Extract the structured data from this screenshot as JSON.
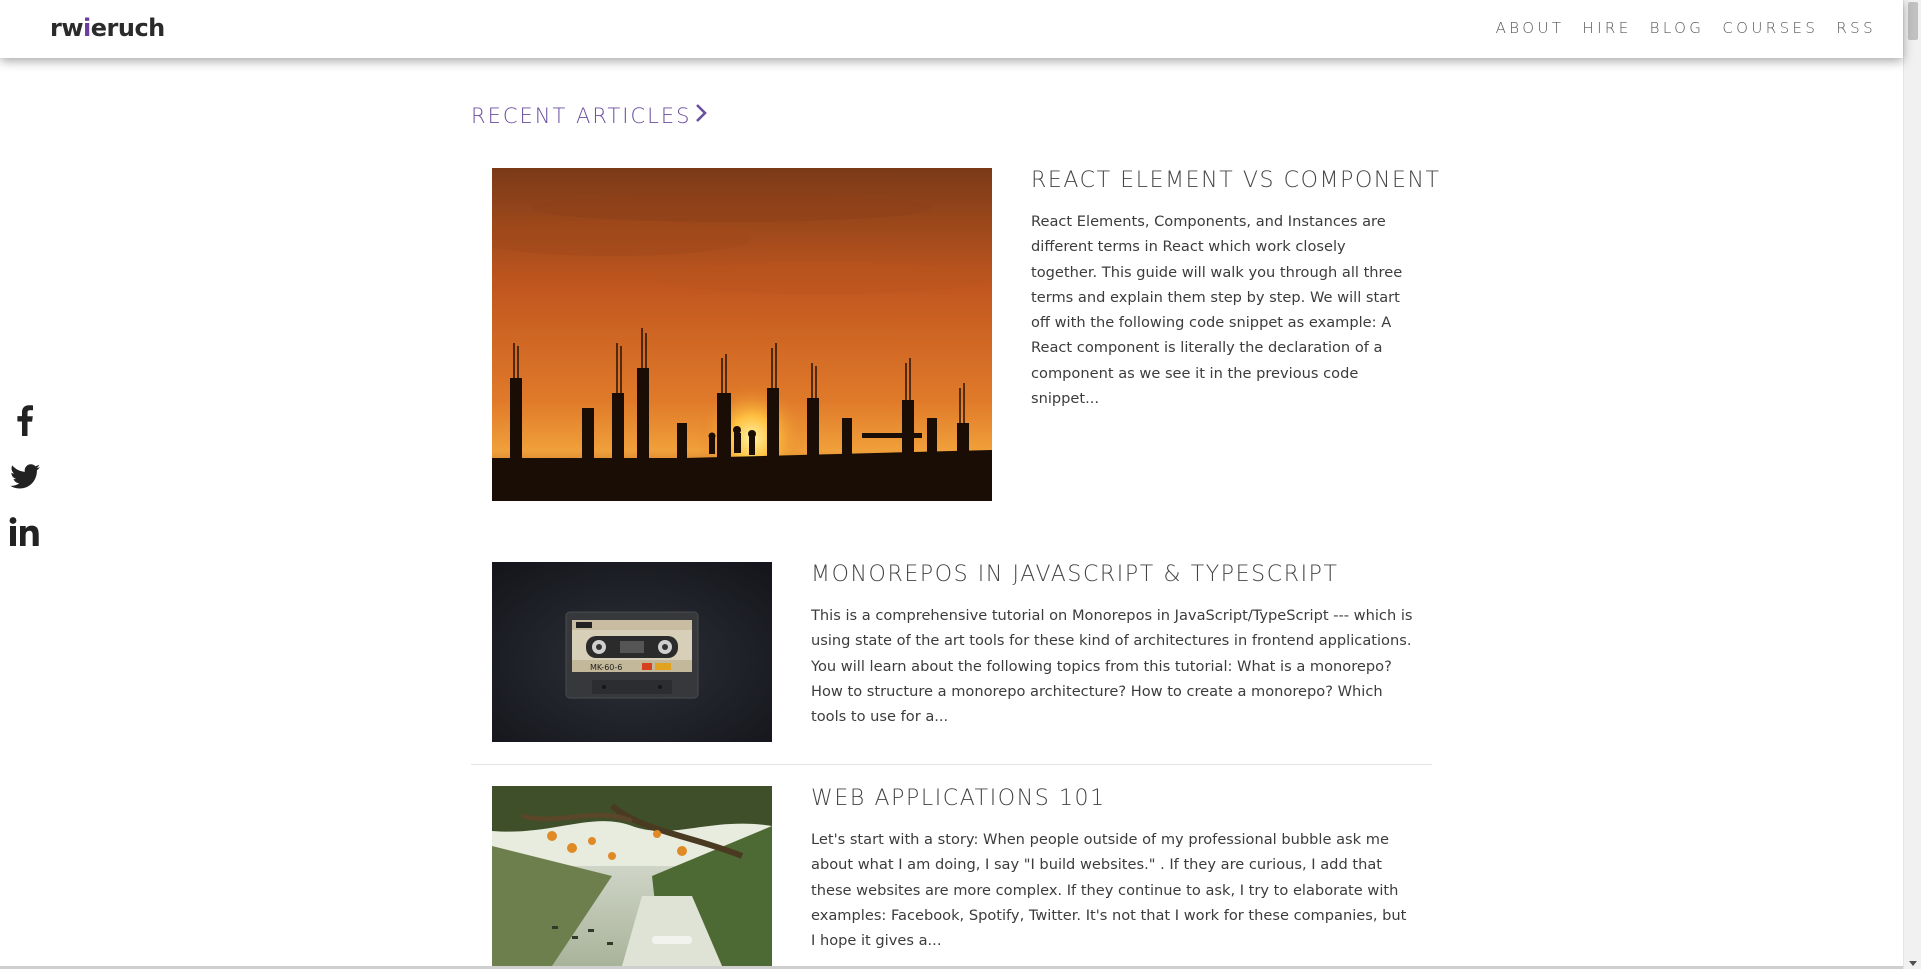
{
  "header": {
    "logo_prefix": "rw",
    "logo_dot": "i",
    "logo_suffix": "eruch",
    "nav": [
      "ABOUT",
      "HIRE",
      "BLOG",
      "COURSES",
      "RSS"
    ]
  },
  "social": {
    "icons": [
      "facebook-icon",
      "twitter-icon",
      "linkedin-icon"
    ]
  },
  "section": {
    "title": "RECENT ARTICLES"
  },
  "articles": [
    {
      "title": "REACT ELEMENT VS COMPONENT",
      "excerpt": "React Elements, Components, and Instances are different terms in React which work closely together. This guide will walk you through all three terms and explain them step by step. We will start off with the following code snippet as example: A React component is literally the declaration of a component as we see it in the previous code snippet...",
      "image": "sunset-construction-silhouette"
    },
    {
      "title": "MONOREPOS IN JAVASCRIPT & TYPESCRIPT",
      "excerpt": "This is a comprehensive tutorial on Monorepos in JavaScript/TypeScript --- which is using state of the art tools for these kind of architectures in frontend applications. You will learn about the following topics from this tutorial: What is a monorepo? How to structure a monorepo architecture? How to create a monorepo? Which tools to use for a...",
      "image": "cassette-tape",
      "cassette_label": "MK-60-6"
    },
    {
      "title": "WEB APPLICATIONS 101",
      "excerpt": "Let's start with a story: When people outside of my professional bubble ask me about what I am doing, I say \"I build websites.\" . If they are curious, I add that these websites are more complex. If they continue to ask, I try to elaborate with examples: Facebook, Spotify, Twitter. It's not that I work for these companies, but I hope it gives a...",
      "image": "canal-with-lanterns"
    }
  ],
  "colors": {
    "accent": "#6b4fa0",
    "text": "#3c3c3c"
  }
}
